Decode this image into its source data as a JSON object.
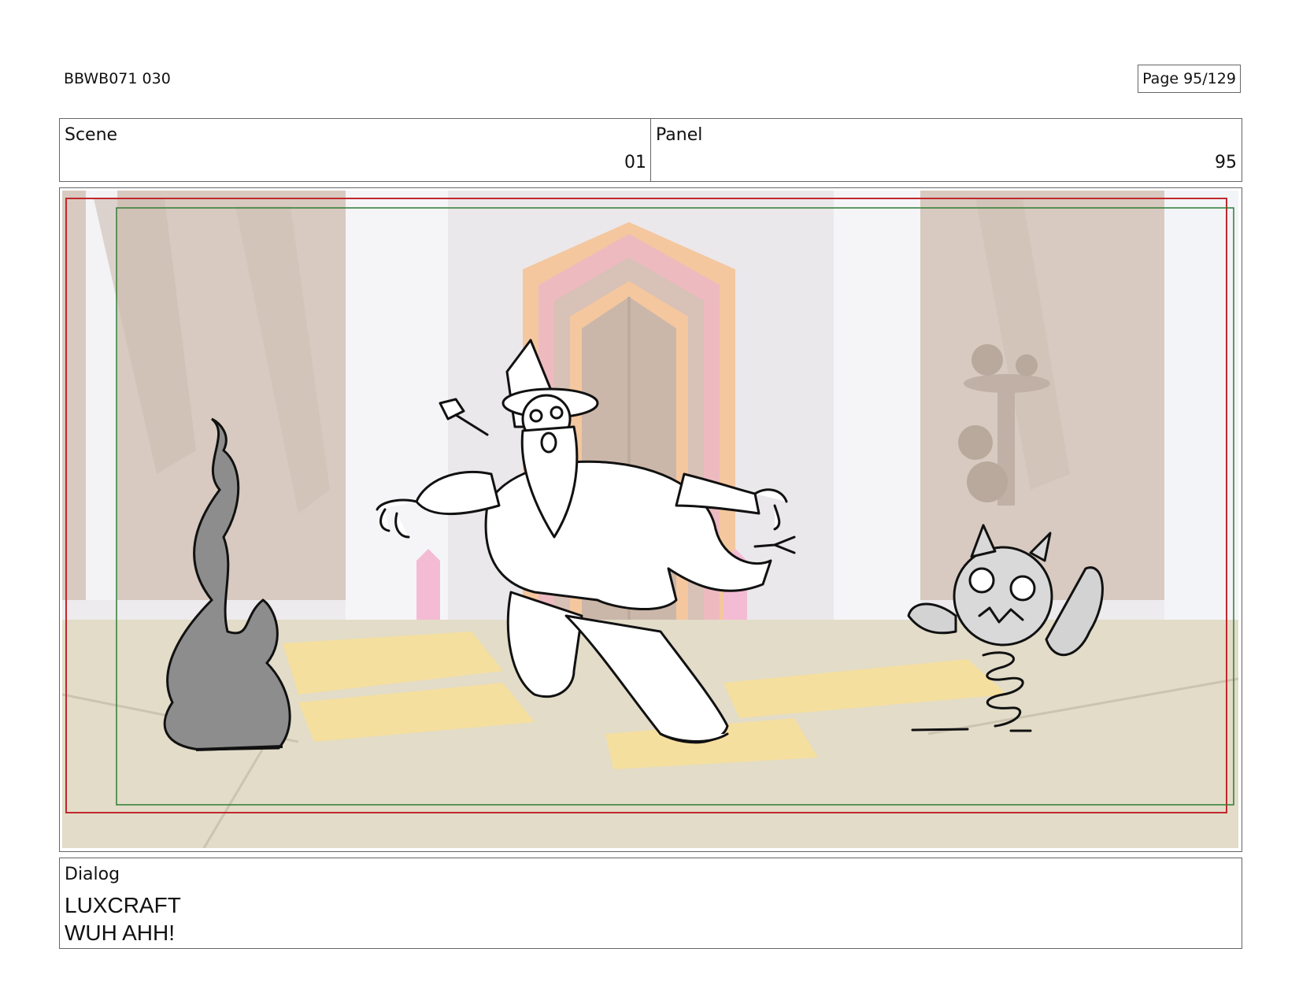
{
  "header": {
    "doc_id": "BBWB071 030",
    "page_label": "Page",
    "page_value": "95/129"
  },
  "scene": {
    "label": "Scene",
    "value": "01"
  },
  "panel": {
    "label": "Panel",
    "value": "95"
  },
  "artwork": {
    "description_icon": "storyboard-sketch-icon",
    "safe_frame_colors": {
      "outer": "#c0282d",
      "inner": "#2e7d32"
    }
  },
  "dialog": {
    "label": "Dialog",
    "speaker": "LUXCRAFT",
    "line": "WUH AHH!"
  }
}
